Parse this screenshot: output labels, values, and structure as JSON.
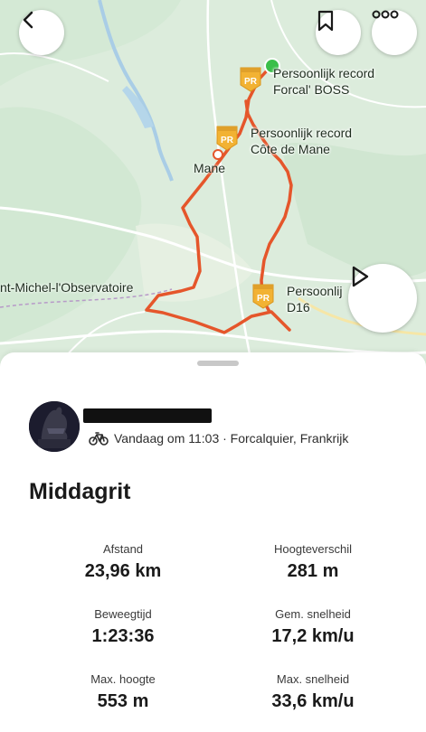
{
  "map": {
    "places": {
      "mane": "Mane",
      "observatoire": "nt-Michel-l'Observatoire"
    },
    "pr_badge_text": "PR",
    "segments": [
      {
        "line1": "Persoonlijk record",
        "line2": "Forcal' BOSS"
      },
      {
        "line1": "Persoonlijk record",
        "line2": "Côte de Mane"
      },
      {
        "line1": "Persoonlij",
        "line2": "D16"
      }
    ],
    "route_color": "#e5562b",
    "start_marker_color": "#3bbf4a",
    "pr_badge_color": "#f2b233"
  },
  "nav": {
    "back_icon": "chevron-left-icon",
    "bookmark_icon": "bookmark-icon",
    "more_icon": "more-dots-icon",
    "play_icon": "play-icon"
  },
  "activity": {
    "meta": "Vandaag om 11:03 · Forcalquier, Frankrijk",
    "sport_icon": "bike-icon",
    "title": "Middagrit"
  },
  "stats": [
    {
      "label": "Afstand",
      "value": "23,96 km"
    },
    {
      "label": "Hoogteverschil",
      "value": "281 m"
    },
    {
      "label": "Beweegtijd",
      "value": "1:23:36"
    },
    {
      "label": "Gem. snelheid",
      "value": "17,2 km/u"
    },
    {
      "label": "Max. hoogte",
      "value": "553 m"
    },
    {
      "label": "Max. snelheid",
      "value": "33,6 km/u"
    }
  ]
}
